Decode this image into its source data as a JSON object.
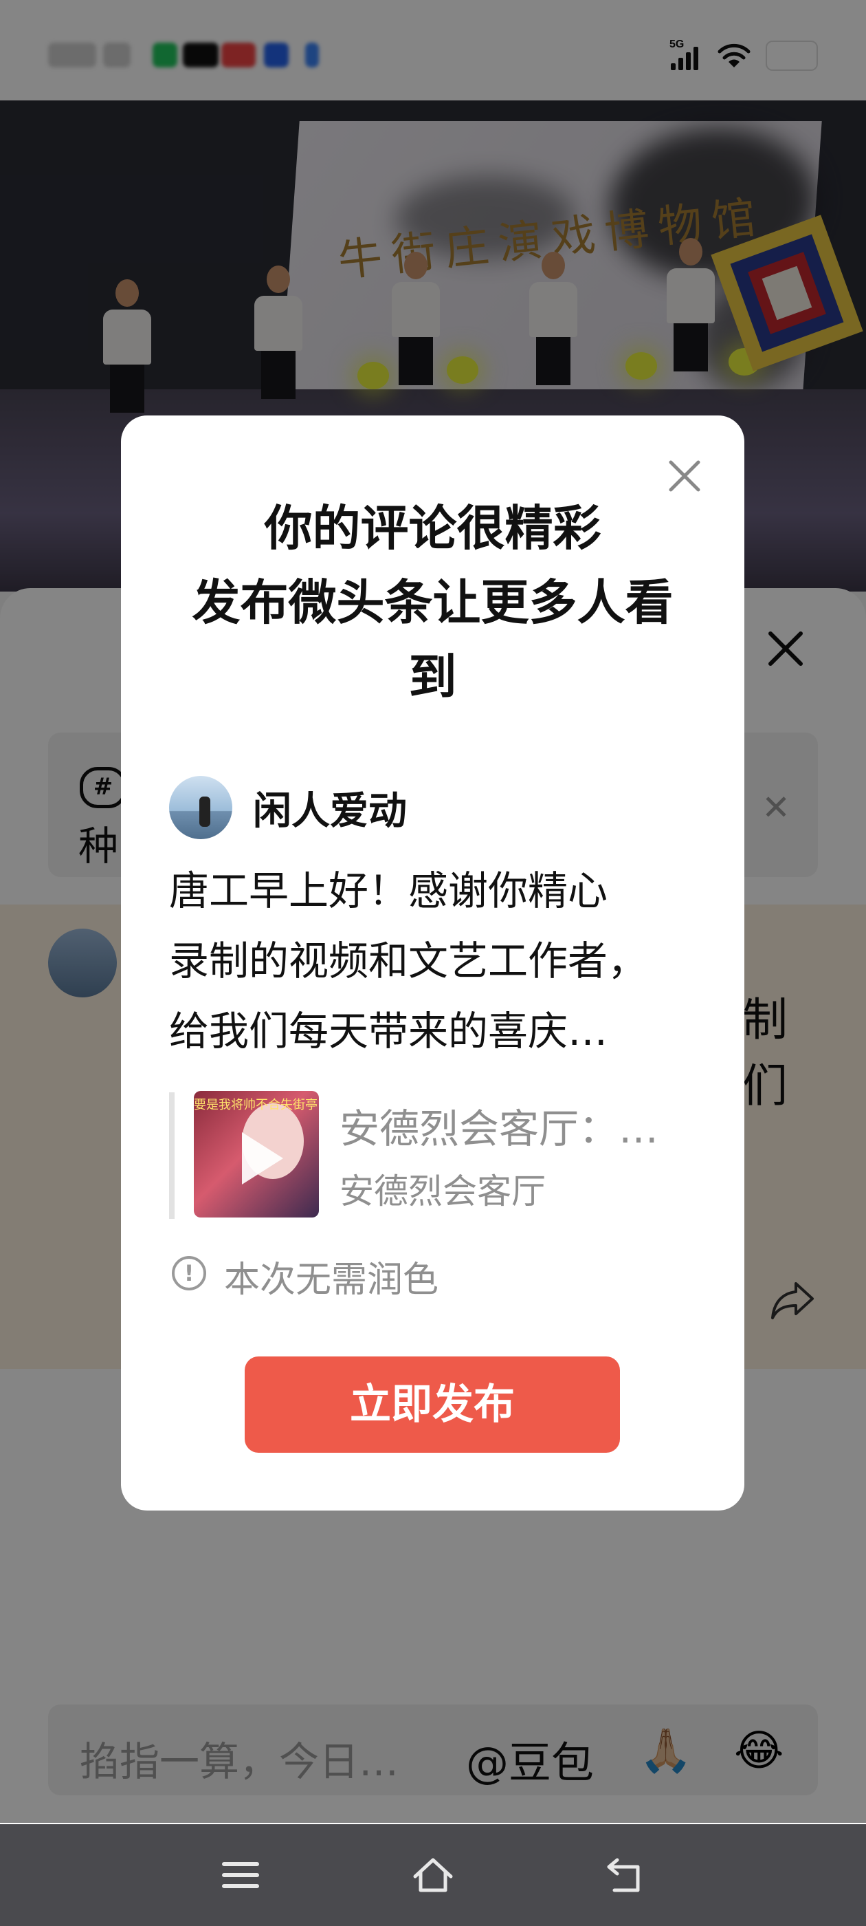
{
  "status_bar": {
    "network_label": "5G"
  },
  "video": {
    "backdrop_text": "牛街庄演戏博物馆"
  },
  "comment_panel": {
    "topic_icon": "#",
    "topic_text": "种",
    "background_comment_fragment": [
      "制",
      "们"
    ]
  },
  "modal": {
    "title_line1": "你的评论很精彩",
    "title_line2": "发布微头条让更多人看",
    "title_line3": "到",
    "author_name": "闲人爱动",
    "comment_line1": "唐工早上好！感谢你精心",
    "comment_line2": "录制的视频和文艺工作者，",
    "comment_line3": "给我们每天带来的喜庆…",
    "quoted_video": {
      "thumbnail_caption": "要是我将帅不合失街亭",
      "title": "安德烈会客厅：…",
      "author": "安德烈会客厅"
    },
    "notice_icon": "!",
    "notice_text": "本次无需润色",
    "publish_button_label": "立即发布"
  },
  "composer": {
    "placeholder": "掐指一算，今日…",
    "mention": "@豆包",
    "emoji_1": "🙏🏼",
    "emoji_2": "😂"
  },
  "icons": {
    "status": [
      "signal-5g-icon",
      "wifi-icon",
      "battery-icon"
    ],
    "modal": [
      "close-icon",
      "info-icon",
      "play-icon"
    ],
    "panel": [
      "close-icon",
      "hashtag-icon",
      "share-icon"
    ],
    "nav": [
      "menu-icon",
      "home-icon",
      "back-icon"
    ]
  },
  "colors": {
    "accent": "#ee5a4a",
    "overlay": "rgba(0,0,0,0.48)",
    "comment_highlight": "#fcefdf",
    "nav_bar": "#4a4a4e"
  }
}
